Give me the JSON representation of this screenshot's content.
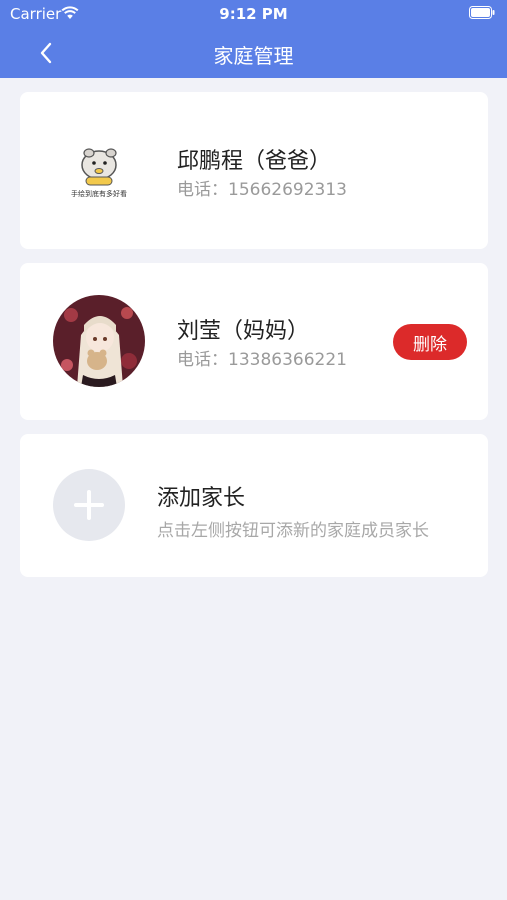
{
  "status_bar": {
    "carrier": "Carrier",
    "time": "9:12 PM"
  },
  "nav": {
    "title": "家庭管理",
    "back_icon": "chevron-left-icon"
  },
  "members": [
    {
      "name": "邱鹏程（爸爸）",
      "phone": "电话：15662692313",
      "avatar_caption": "手绘到底有多好看"
    },
    {
      "name": "刘莹（妈妈）",
      "phone": "电话：13386366221",
      "delete_label": "删除"
    }
  ],
  "add_parent": {
    "title": "添加家长",
    "hint": "点击左侧按钮可添新的家庭成员家长"
  },
  "colors": {
    "header": "#5a7fe6",
    "background": "#f1f2f8",
    "delete": "#dc2a2a"
  }
}
